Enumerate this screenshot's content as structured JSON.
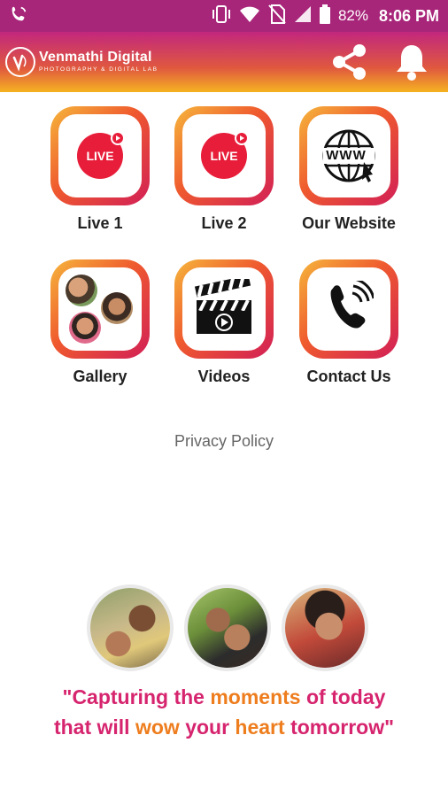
{
  "status_bar": {
    "battery": "82%",
    "time": "8:06 PM",
    "icons": [
      "phone-wifi-call-icon",
      "vibrate-icon",
      "wifi-icon",
      "no-sim-icon",
      "signal-icon",
      "battery-icon"
    ]
  },
  "header": {
    "logo_title": "Venmathi Digital",
    "logo_subtitle": "PHOTOGRAPHY & DIGITAL LAB",
    "icons": [
      "share-icon",
      "bell-icon"
    ]
  },
  "tiles": [
    {
      "label": "Live 1",
      "badge": "LIVE",
      "icon": "live-icon"
    },
    {
      "label": "Live 2",
      "badge": "LIVE",
      "icon": "live-icon"
    },
    {
      "label": "Our Website",
      "badge": "WWW",
      "icon": "globe-www-icon"
    },
    {
      "label": "Gallery",
      "icon": "gallery-photos-icon"
    },
    {
      "label": "Videos",
      "icon": "clapperboard-icon"
    },
    {
      "label": "Contact Us",
      "icon": "phone-call-icon"
    }
  ],
  "privacy_policy": "Privacy Policy",
  "tagline": {
    "line1": [
      {
        "text": "\"Capturing the ",
        "color": "pink"
      },
      {
        "text": "moments ",
        "color": "orange"
      },
      {
        "text": "of today",
        "color": "pink"
      }
    ],
    "line2": [
      {
        "text": "that will ",
        "color": "pink"
      },
      {
        "text": "wow ",
        "color": "orange"
      },
      {
        "text": "your ",
        "color": "pink"
      },
      {
        "text": "heart ",
        "color": "orange"
      },
      {
        "text": "tomorrow\"",
        "color": "pink"
      }
    ]
  },
  "colors": {
    "status_bar": "#a8267a",
    "tile_gradient": [
      "#f6b73c",
      "#ef5a2e",
      "#d21f57"
    ],
    "live_red": "#e81d3a",
    "tagline_pink": "#d6246e",
    "tagline_orange": "#ee7d1e"
  }
}
